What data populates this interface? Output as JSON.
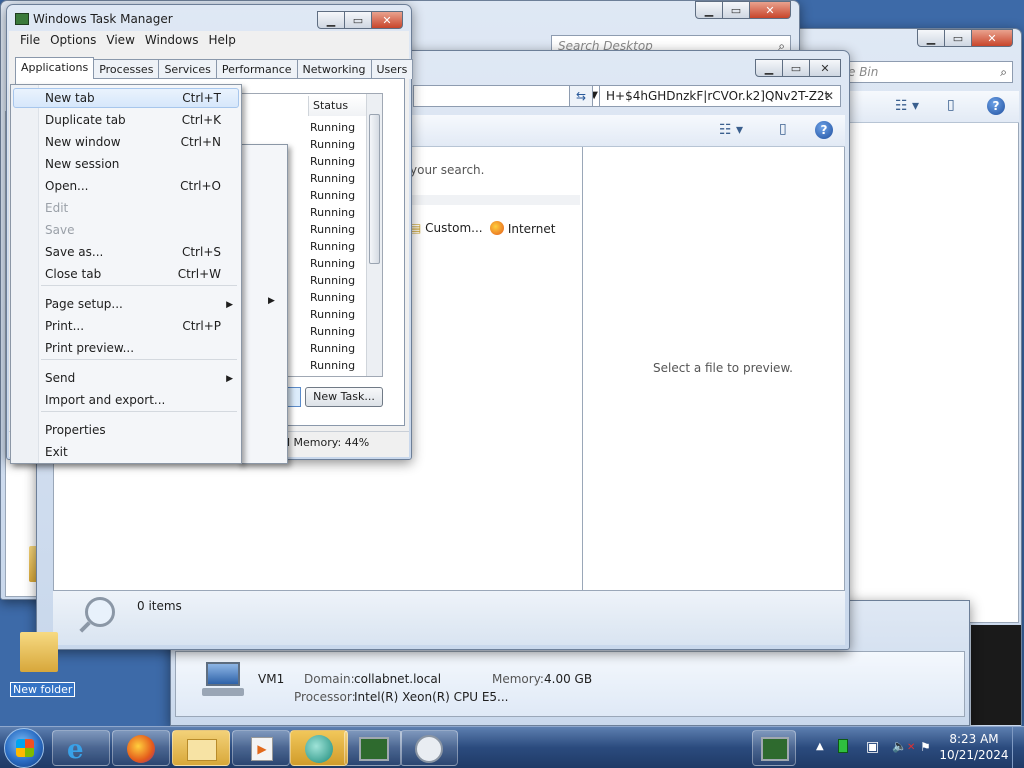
{
  "desktop": {
    "new_folder_label": "New folder"
  },
  "window_desktop": {
    "search_placeholder": "Search Desktop"
  },
  "window_recycle": {
    "search_placeholder": "Search Recycle Bin",
    "search_visible": "e Bin"
  },
  "window_ie": {
    "address_text": "H+$4hGHDnzkF|rCVOr.k2]QNv2T-Z2t",
    "no_results": "your search.",
    "search_sources": [
      {
        "label": "Custom...",
        "icon": "custom-search-icon"
      },
      {
        "label": "Internet",
        "icon": "firefox-icon"
      }
    ],
    "preview_text": "Select a file to preview.",
    "status_count": "0 items"
  },
  "computer_panel": {
    "name": "VM1",
    "domain_label": "Domain:",
    "domain_value": "collabnet.local",
    "memory_label": "Memory:",
    "memory_value": "4.00 GB",
    "processor_label": "Processor:",
    "processor_value": "Intel(R) Xeon(R) CPU E5..."
  },
  "task_manager": {
    "title": "Windows Task Manager",
    "menu": [
      "File",
      "Options",
      "View",
      "Windows",
      "Help"
    ],
    "tabs": [
      "Applications",
      "Processes",
      "Services",
      "Performance",
      "Networking",
      "Users"
    ],
    "column_status": "Status",
    "rows": [
      "Running",
      "Running",
      "Running",
      "Running",
      "Running",
      "Running",
      "Running",
      "Running",
      "Running",
      "Running",
      "Running",
      "Running",
      "Running",
      "Running",
      "Running"
    ],
    "new_task_label": "New Task...",
    "status_memory": "l Memory: 44%"
  },
  "file_menu": {
    "items": [
      {
        "label": "New tab",
        "shortcut": "Ctrl+T",
        "enabled": true
      },
      {
        "label": "Duplicate tab",
        "shortcut": "Ctrl+K",
        "enabled": true
      },
      {
        "label": "New window",
        "shortcut": "Ctrl+N",
        "enabled": true
      },
      {
        "label": "New session",
        "shortcut": "",
        "enabled": true
      },
      {
        "label": "Open...",
        "shortcut": "Ctrl+O",
        "enabled": true
      },
      {
        "label": "Edit",
        "shortcut": "",
        "enabled": false
      },
      {
        "label": "Save",
        "shortcut": "",
        "enabled": false
      },
      {
        "label": "Save as...",
        "shortcut": "Ctrl+S",
        "enabled": true
      },
      {
        "label": "Close tab",
        "shortcut": "Ctrl+W",
        "enabled": true
      },
      {
        "label": "Page setup...",
        "shortcut": "",
        "enabled": true
      },
      {
        "label": "Print...",
        "shortcut": "Ctrl+P",
        "enabled": true
      },
      {
        "label": "Print preview...",
        "shortcut": "",
        "enabled": true
      },
      {
        "label": "Send",
        "shortcut": "",
        "enabled": true
      },
      {
        "label": "Import and export...",
        "shortcut": "",
        "enabled": true
      },
      {
        "label": "Properties",
        "shortcut": "",
        "enabled": true
      },
      {
        "label": "Exit",
        "shortcut": "",
        "enabled": true
      }
    ]
  },
  "clock": {
    "time": "8:23 AM",
    "date": "10/21/2024"
  },
  "colors": {
    "accent": "#3a6fb8",
    "close_red": "#c8452b",
    "taskbar": "#2b4b7e"
  }
}
